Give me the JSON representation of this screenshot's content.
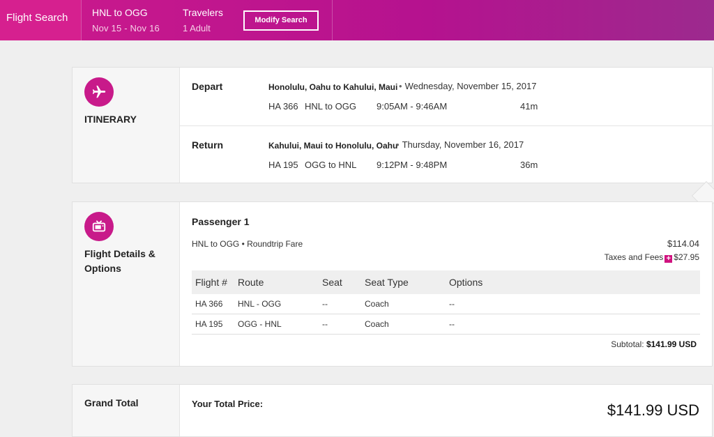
{
  "header": {
    "title": "Flight Search",
    "route": "HNL to OGG",
    "dates": "Nov 15 - Nov 16",
    "travelers_label": "Travelers",
    "travelers_value": "1 Adult",
    "modify_label": "Modify Search"
  },
  "itinerary": {
    "label": "ITINERARY",
    "icon": "plane-icon",
    "legs": [
      {
        "direction": "Depart",
        "cities": "Honolulu, Oahu to Kahului, Maui",
        "date": "Wednesday, November 15, 2017",
        "flight": "HA 366",
        "route": "HNL to OGG",
        "times": "9:05AM - 9:46AM",
        "duration": "41m"
      },
      {
        "direction": "Return",
        "cities": "Kahului, Maui to Honolulu, Oahu",
        "date": "Thursday, November 16, 2017",
        "flight": "HA 195",
        "route": "OGG to HNL",
        "times": "9:12PM - 9:48PM",
        "duration": "36m"
      }
    ]
  },
  "details": {
    "label": "Flight Details & Options",
    "icon": "tv-icon",
    "passenger": "Passenger 1",
    "fare_desc": "HNL to OGG • Roundtrip Fare",
    "fare_price": "$114.04",
    "taxes_label": "Taxes and Fees",
    "taxes_price": "$27.95",
    "columns": [
      "Flight #",
      "Route",
      "Seat",
      "Seat Type",
      "Options"
    ],
    "rows": [
      [
        "HA 366",
        "HNL - OGG",
        "--",
        "Coach",
        "--"
      ],
      [
        "HA 195",
        "OGG - HNL",
        "--",
        "Coach",
        "--"
      ]
    ],
    "subtotal_label": "Subtotal:",
    "subtotal_value": "$141.99 USD"
  },
  "grand_total": {
    "label": "Grand Total",
    "price_label": "Your Total Price:",
    "price_value": "$141.99 USD"
  },
  "colors": {
    "brand": "#c81a8a",
    "header_gradient_end": "#9c2a8e"
  }
}
